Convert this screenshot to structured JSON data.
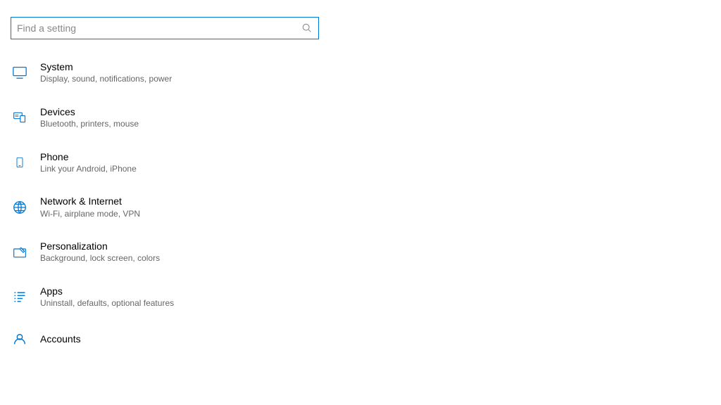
{
  "search": {
    "placeholder": "Find a setting"
  },
  "categories": {
    "system": {
      "title": "System",
      "desc": "Display, sound, notifications, power"
    },
    "devices": {
      "title": "Devices",
      "desc": "Bluetooth, printers, mouse"
    },
    "phone": {
      "title": "Phone",
      "desc": "Link your Android, iPhone"
    },
    "network": {
      "title": "Network & Internet",
      "desc": "Wi-Fi, airplane mode, VPN"
    },
    "personalization": {
      "title": "Personalization",
      "desc": "Background, lock screen, colors"
    },
    "apps": {
      "title": "Apps",
      "desc": "Uninstall, defaults, optional features"
    },
    "accounts": {
      "title": "Accounts",
      "desc": ""
    }
  }
}
